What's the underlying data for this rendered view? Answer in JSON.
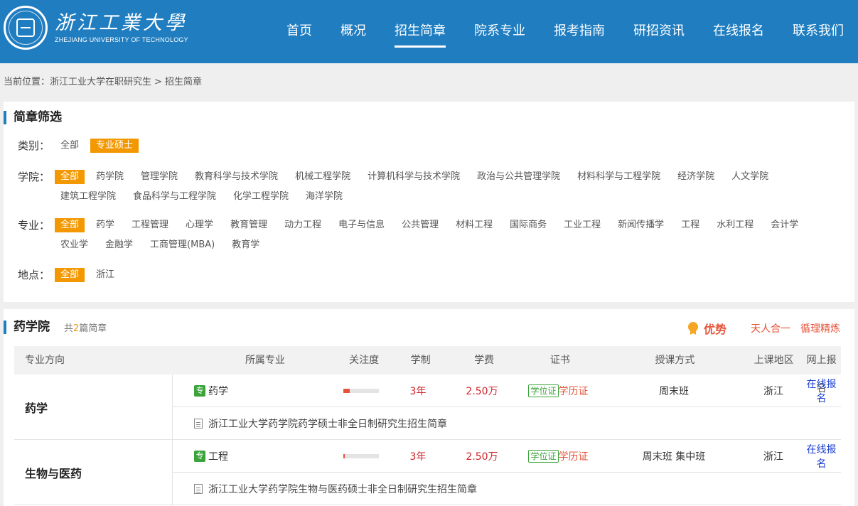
{
  "header": {
    "logo_cn": "浙江工業大學",
    "logo_en": "ZHEJIANG UNIVERSITY OF TECHNOLOGY",
    "nav": [
      {
        "label": "首页",
        "active": false
      },
      {
        "label": "概况",
        "active": false
      },
      {
        "label": "招生简章",
        "active": true
      },
      {
        "label": "院系专业",
        "active": false
      },
      {
        "label": "报考指南",
        "active": false
      },
      {
        "label": "研招资讯",
        "active": false
      },
      {
        "label": "在线报名",
        "active": false
      },
      {
        "label": "联系我们",
        "active": false
      }
    ]
  },
  "breadcrumb": {
    "prefix": "当前位置：",
    "home": "浙江工业大学在职研究生",
    "sep": ">",
    "current": "招生简章"
  },
  "filter": {
    "title": "简章筛选",
    "rows": [
      {
        "label": "类别：",
        "options": [
          {
            "text": "全部",
            "on": false
          },
          {
            "text": "专业硕士",
            "on": true
          }
        ]
      },
      {
        "label": "学院：",
        "options": [
          {
            "text": "全部",
            "on": true
          },
          {
            "text": "药学院",
            "on": false
          },
          {
            "text": "管理学院",
            "on": false
          },
          {
            "text": "教育科学与技术学院",
            "on": false
          },
          {
            "text": "机械工程学院",
            "on": false
          },
          {
            "text": "计算机科学与技术学院",
            "on": false
          },
          {
            "text": "政治与公共管理学院",
            "on": false
          },
          {
            "text": "材料科学与工程学院",
            "on": false
          },
          {
            "text": "经济学院",
            "on": false
          },
          {
            "text": "人文学院",
            "on": false
          },
          {
            "text": "建筑工程学院",
            "on": false
          },
          {
            "text": "食品科学与工程学院",
            "on": false
          },
          {
            "text": "化学工程学院",
            "on": false
          },
          {
            "text": "海洋学院",
            "on": false
          }
        ]
      },
      {
        "label": "专业：",
        "options": [
          {
            "text": "全部",
            "on": true
          },
          {
            "text": "药学",
            "on": false
          },
          {
            "text": "工程管理",
            "on": false
          },
          {
            "text": "心理学",
            "on": false
          },
          {
            "text": "教育管理",
            "on": false
          },
          {
            "text": "动力工程",
            "on": false
          },
          {
            "text": "电子与信息",
            "on": false
          },
          {
            "text": "公共管理",
            "on": false
          },
          {
            "text": "材料工程",
            "on": false
          },
          {
            "text": "国际商务",
            "on": false
          },
          {
            "text": "工业工程",
            "on": false
          },
          {
            "text": "新闻传播学",
            "on": false
          },
          {
            "text": "工程",
            "on": false
          },
          {
            "text": "水利工程",
            "on": false
          },
          {
            "text": "会计学",
            "on": false
          },
          {
            "text": "农业学",
            "on": false
          },
          {
            "text": "金融学",
            "on": false
          },
          {
            "text": "工商管理(MBA)",
            "on": false
          },
          {
            "text": "教育学",
            "on": false
          }
        ]
      },
      {
        "label": "地点：",
        "options": [
          {
            "text": "全部",
            "on": true
          },
          {
            "text": "浙江",
            "on": false
          }
        ]
      }
    ]
  },
  "college": {
    "name": "药学院",
    "count_prefix": "共",
    "count": "2",
    "count_suffix": "篇简章",
    "advantage": "优势",
    "tags": [
      "天人合一",
      "循理精炼"
    ],
    "headers": {
      "dir": "专业方向",
      "major": "所属专业",
      "attention": "关注度",
      "system": "学制",
      "fee": "学费",
      "cert": "证书",
      "mode": "授课方式",
      "area": "上课地区",
      "apply": "网上报名"
    },
    "groups": [
      {
        "direction": "药学",
        "badge": "专",
        "major": "药学",
        "attention": 0.18,
        "system": "3年",
        "fee": "2.50万",
        "cert_box": "学位证",
        "cert_text": "学历证",
        "mode": "周末班",
        "area": "浙江",
        "apply": "在线报名",
        "brochure": "浙江工业大学药学院药学硕士非全日制研究生招生简章"
      },
      {
        "direction": "生物与医药",
        "badge": "专",
        "major": "工程",
        "attention": 0.03,
        "system": "3年",
        "fee": "2.50万",
        "cert_box": "学位证",
        "cert_text": "学历证",
        "mode": "周末班 集中班",
        "area": "浙江",
        "apply": "在线报名",
        "brochure": "浙江工业大学药学院生物与医药硕士非全日制研究生招生简章"
      }
    ]
  }
}
